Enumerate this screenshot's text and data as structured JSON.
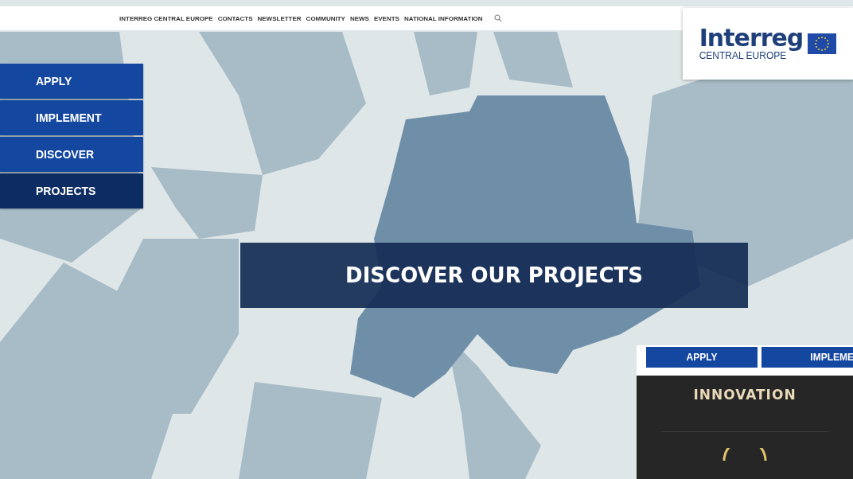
{
  "top_nav": {
    "links": [
      "INTERREG CENTRAL EUROPE",
      "CONTACTS",
      "NEWSLETTER",
      "COMMUNITY",
      "NEWS",
      "EVENTS",
      "NATIONAL INFORMATION"
    ]
  },
  "logo": {
    "name": "Interreg",
    "subtitle": "CENTRAL EUROPE"
  },
  "side_menu": [
    {
      "label": "APPLY",
      "selected": false
    },
    {
      "label": "IMPLEMENT",
      "selected": false
    },
    {
      "label": "DISCOVER",
      "selected": false
    },
    {
      "label": "PROJECTS",
      "selected": true
    }
  ],
  "banner": {
    "title": "DISCOVER OUR PROJECTS"
  },
  "mobile_preview": {
    "tabs": [
      "APPLY",
      "IMPLEME"
    ],
    "card_title": "INNOVATION"
  }
}
